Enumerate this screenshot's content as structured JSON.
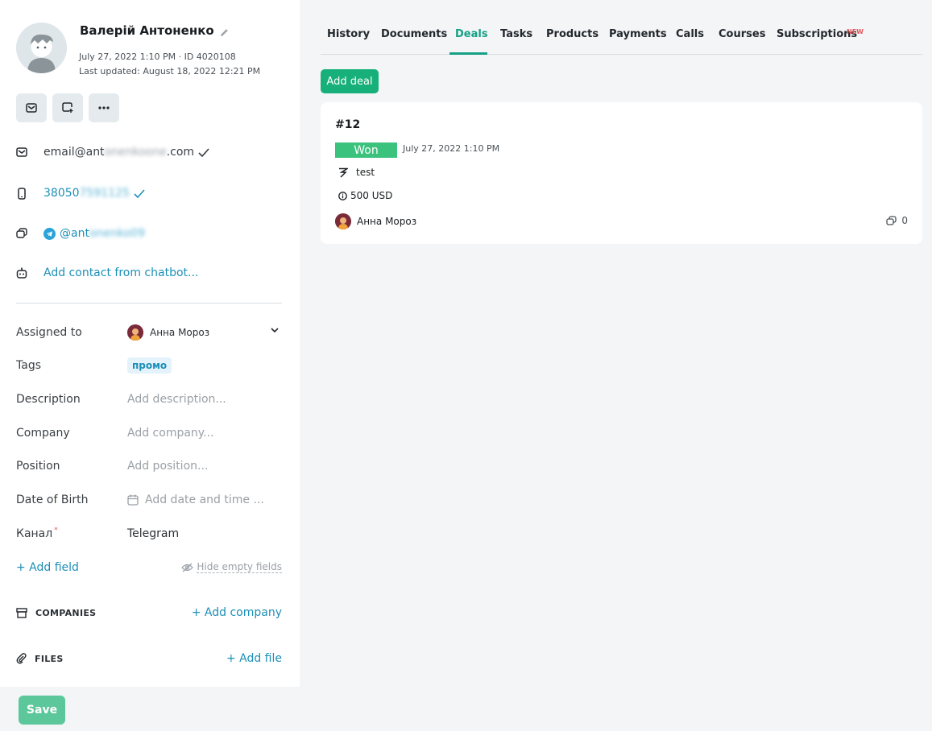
{
  "contact": {
    "name": "Валерій Антоненко",
    "created": "July 27, 2022 1:10 PM",
    "id_text": "· ID 4020108",
    "last_updated": "Last updated: August 18, 2022 12:21 PM"
  },
  "channels": {
    "email_prefix": "email@ant",
    "email_blurred": "onenkoone",
    "email_suffix": ".com",
    "phone_prefix": "38050",
    "phone_blurred": "7591125",
    "telegram_prefix": "@ant",
    "telegram_blurred": "onenko09",
    "chatbot_link": "Add contact from chatbot..."
  },
  "fields": {
    "assigned_label": "Assigned to",
    "assigned_value": "Анна Мороз",
    "tags_label": "Tags",
    "tag_value": "промо",
    "description_label": "Description",
    "description_placeholder": "Add description...",
    "company_label": "Company",
    "company_placeholder": "Add company...",
    "position_label": "Position",
    "position_placeholder": "Add position...",
    "dob_label": "Date of Birth",
    "dob_placeholder": "Add date and time ...",
    "channel_label": "Канал",
    "channel_required_mark": "*",
    "channel_value": "Telegram",
    "add_field": "+ Add field",
    "hide_empty": "Hide empty fields"
  },
  "sections": {
    "companies_title": "COMPANIES",
    "add_company": "+ Add company",
    "files_title": "FILES",
    "add_file": "+ Add file"
  },
  "save_label": "Save",
  "tabs": [
    {
      "label": "History"
    },
    {
      "label": "Documents"
    },
    {
      "label": "Deals"
    },
    {
      "label": "Tasks"
    },
    {
      "label": "Products"
    },
    {
      "label": "Payments"
    },
    {
      "label": "Calls"
    },
    {
      "label": "Courses"
    },
    {
      "label": "Subscriptions"
    }
  ],
  "new_badge": "NEW",
  "active_tab": "Deals",
  "add_deal_label": "Add deal",
  "deal": {
    "number": "#12",
    "status": "Won",
    "date": "July 27, 2022 1:10 PM",
    "pipeline": "test",
    "amount": "500 USD",
    "owner": "Анна Мороз",
    "comments_count": "0"
  },
  "colors": {
    "accent": "#16a085",
    "link": "#1d8fb8",
    "won": "#3bc27d",
    "save": "#5cc79a"
  }
}
